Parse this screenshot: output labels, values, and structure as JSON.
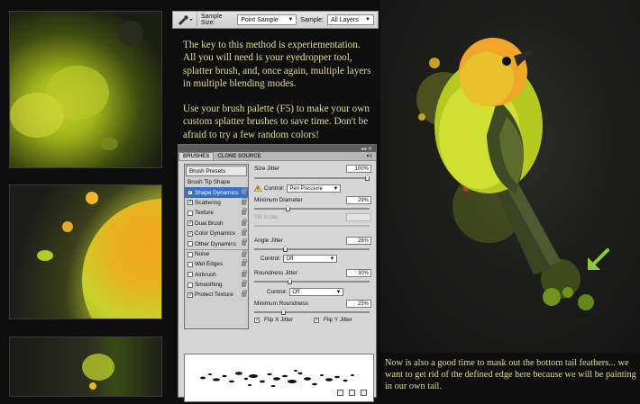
{
  "toolbar": {
    "tool_icon": "eyedropper-icon",
    "sample_size_label": "Sample Size:",
    "sample_size_value": "Point Sample",
    "sample_label": "Sample:",
    "sample_value": "All Layers"
  },
  "copy": {
    "intro": "The key to this method is experiementation. All you will need is your eyedropper tool, splatter brush, and, once again, multiple layers in multiple blending modes.",
    "tip": "Use your brush palette (F5) to make your own custom splatter brushes to save time. Don't be afraid to try a few random colors!",
    "mask_note": "Now is also a good time to mask out the bottom tail feathers... we want to get rid of the defined edge here because we will be painting in our own tail."
  },
  "palette": {
    "tabs": [
      "BRUSHES",
      "CLONE SOURCE"
    ],
    "active_tab": "BRUSHES",
    "top_bar_icons": "collapse-double-arrow-icon",
    "menu_icon": "palette-menu-icon",
    "list_items": [
      {
        "label": "Brush Presets",
        "type": "header"
      },
      {
        "label": "Brush Tip Shape",
        "type": "plain"
      },
      {
        "label": "Shape Dynamics",
        "checked": true,
        "selected": true
      },
      {
        "label": "Scattering",
        "checked": true
      },
      {
        "label": "Texture",
        "checked": false
      },
      {
        "label": "Dual Brush",
        "checked": true
      },
      {
        "label": "Color Dynamics",
        "checked": true
      },
      {
        "label": "Other Dynamics",
        "checked": false
      },
      {
        "label": "Noise",
        "checked": false
      },
      {
        "label": "Wet Edges",
        "checked": false
      },
      {
        "label": "Airbrush",
        "checked": false
      },
      {
        "label": "Smoothing",
        "checked": false
      },
      {
        "label": "Protect Texture",
        "checked": true
      }
    ],
    "size_jitter": {
      "label": "Size Jitter",
      "value": "100%"
    },
    "control1": {
      "label": "Control:",
      "value": "Pen Pressure"
    },
    "min_diameter": {
      "label": "Minimum Diameter",
      "value": "29%"
    },
    "tilt_scale": {
      "label": "Tilt Scale",
      "value": ""
    },
    "angle_jitter": {
      "label": "Angle Jitter",
      "value": "26%"
    },
    "control2": {
      "label": "Control:",
      "value": "Off"
    },
    "roundness_jitter": {
      "label": "Roundness Jitter",
      "value": "30%"
    },
    "control3": {
      "label": "Control:",
      "value": "Off"
    },
    "min_roundness": {
      "label": "Minimum Roundness",
      "value": "25%"
    },
    "flip_x": {
      "label": "Flip X Jitter",
      "checked": true
    },
    "flip_y": {
      "label": "Flip Y Jitter",
      "checked": true
    }
  },
  "colors": {
    "copy_text": "#e1de8d",
    "selected_item": "#3a6fc9",
    "arrow": "#8fc83a"
  }
}
